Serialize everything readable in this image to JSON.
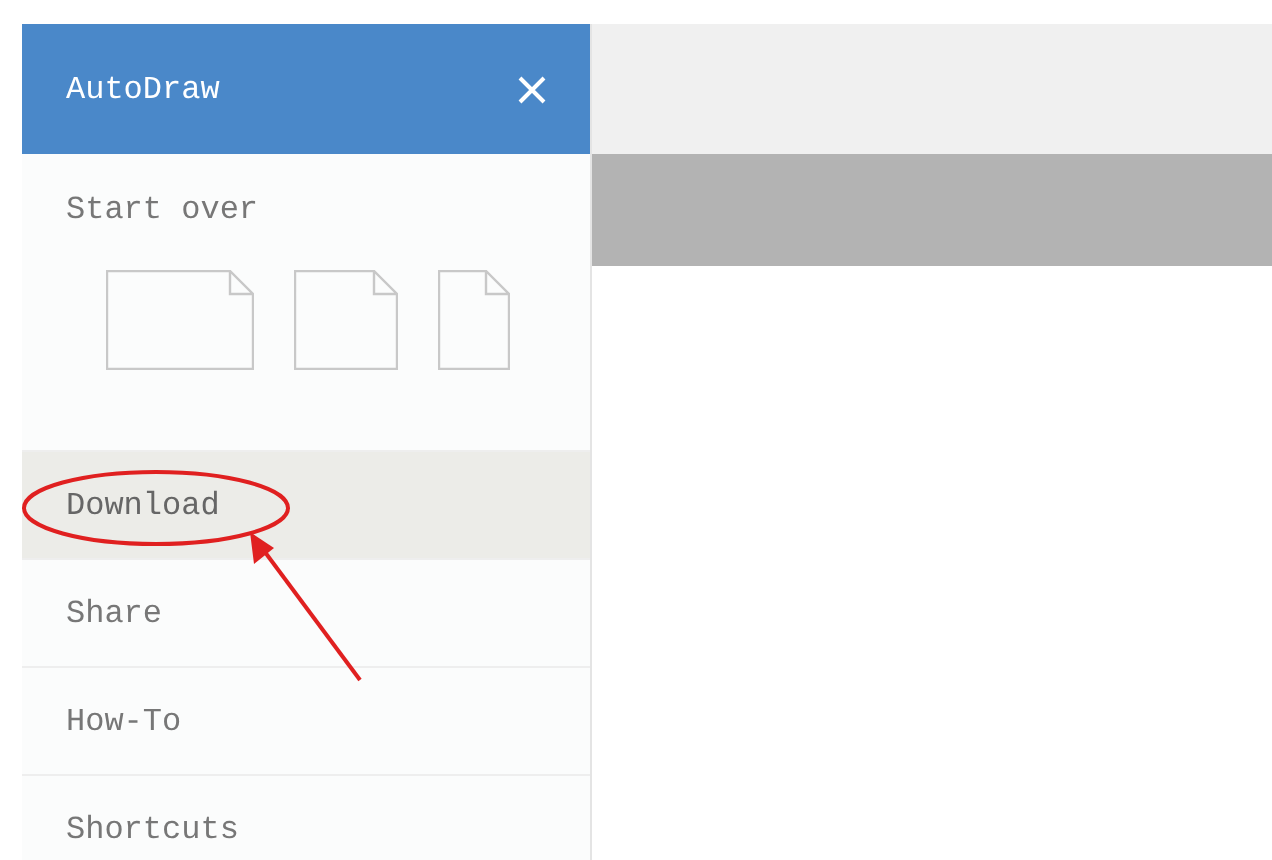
{
  "sidebar": {
    "title": "AutoDraw",
    "start_over": {
      "label": "Start over",
      "page_sizes": [
        {
          "kind": "landscape"
        },
        {
          "kind": "square"
        },
        {
          "kind": "portrait"
        }
      ]
    },
    "items": [
      {
        "label": "Download",
        "selected": true
      },
      {
        "label": "Share",
        "selected": false
      },
      {
        "label": "How-To",
        "selected": false
      },
      {
        "label": "Shortcuts",
        "selected": false
      }
    ]
  }
}
